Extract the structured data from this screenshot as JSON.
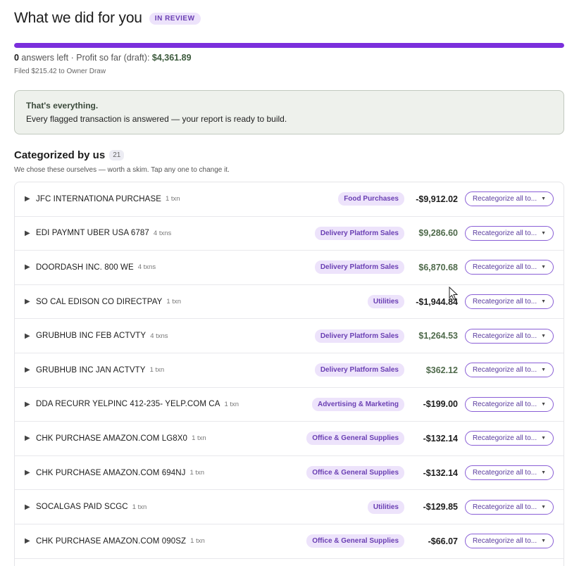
{
  "header": {
    "title": "What we did for you",
    "status": "IN REVIEW"
  },
  "progress": {
    "fraction": 1.0
  },
  "summary": {
    "answers_count": "0",
    "answers_text": " answers left · Profit so far (draft): ",
    "profit": "$4,361.89",
    "filed": "Filed $215.42 to Owner Draw"
  },
  "done": {
    "title": "That's everything.",
    "text": "Every flagged transaction is answered — your report is ready to build."
  },
  "section": {
    "title": "Categorized by us",
    "count": "21",
    "subtitle": "We chose these ourselves — worth a skim. Tap any one to change it."
  },
  "rows": [
    {
      "merchant": "JFC INTERNATIONA PURCHASE",
      "txns": "1 txn",
      "category": "Food Purchases",
      "amount": "-$9,912.02",
      "sign": "neg",
      "action": "Recategorize all to..."
    },
    {
      "merchant": "EDI PAYMNT UBER USA 6787",
      "txns": "4 txns",
      "category": "Delivery Platform Sales",
      "amount": "$9,286.60",
      "sign": "pos",
      "action": "Recategorize all to..."
    },
    {
      "merchant": "DOORDASH INC. 800 WE",
      "txns": "4 txns",
      "category": "Delivery Platform Sales",
      "amount": "$6,870.68",
      "sign": "pos",
      "action": "Recategorize all to..."
    },
    {
      "merchant": "SO CAL EDISON CO DIRECTPAY",
      "txns": "1 txn",
      "category": "Utilities",
      "amount": "-$1,944.84",
      "sign": "neg",
      "action": "Recategorize all to..."
    },
    {
      "merchant": "GRUBHUB INC FEB ACTVTY",
      "txns": "4 txns",
      "category": "Delivery Platform Sales",
      "amount": "$1,264.53",
      "sign": "pos",
      "action": "Recategorize all to..."
    },
    {
      "merchant": "GRUBHUB INC JAN ACTVTY",
      "txns": "1 txn",
      "category": "Delivery Platform Sales",
      "amount": "$362.12",
      "sign": "pos",
      "action": "Recategorize all to..."
    },
    {
      "merchant": "DDA RECURR YELPINC 412-235- YELP.COM CA",
      "txns": "1 txn",
      "category": "Advertising & Marketing",
      "amount": "-$199.00",
      "sign": "neg",
      "action": "Recategorize all to..."
    },
    {
      "merchant": "CHK PURCHASE AMAZON.COM LG8X0",
      "txns": "1 txn",
      "category": "Office & General Supplies",
      "amount": "-$132.14",
      "sign": "neg",
      "action": "Recategorize all to..."
    },
    {
      "merchant": "CHK PURCHASE AMAZON.COM 694NJ",
      "txns": "1 txn",
      "category": "Office & General Supplies",
      "amount": "-$132.14",
      "sign": "neg",
      "action": "Recategorize all to..."
    },
    {
      "merchant": "SOCALGAS PAID SCGC",
      "txns": "1 txn",
      "category": "Utilities",
      "amount": "-$129.85",
      "sign": "neg",
      "action": "Recategorize all to..."
    },
    {
      "merchant": "CHK PURCHASE AMAZON.COM 090SZ",
      "txns": "1 txn",
      "category": "Office & General Supplies",
      "amount": "-$66.07",
      "sign": "neg",
      "action": "Recategorize all to..."
    }
  ],
  "icons": {
    "expand": "caret-right-icon",
    "dropdown": "chevron-down-icon",
    "pointer": "mouse-cursor-icon"
  },
  "colors": {
    "accent": "#7b2fdc",
    "badge_bg": "#ede3fb",
    "badge_text": "#6a3fb3",
    "positive": "#4f6a4b"
  }
}
